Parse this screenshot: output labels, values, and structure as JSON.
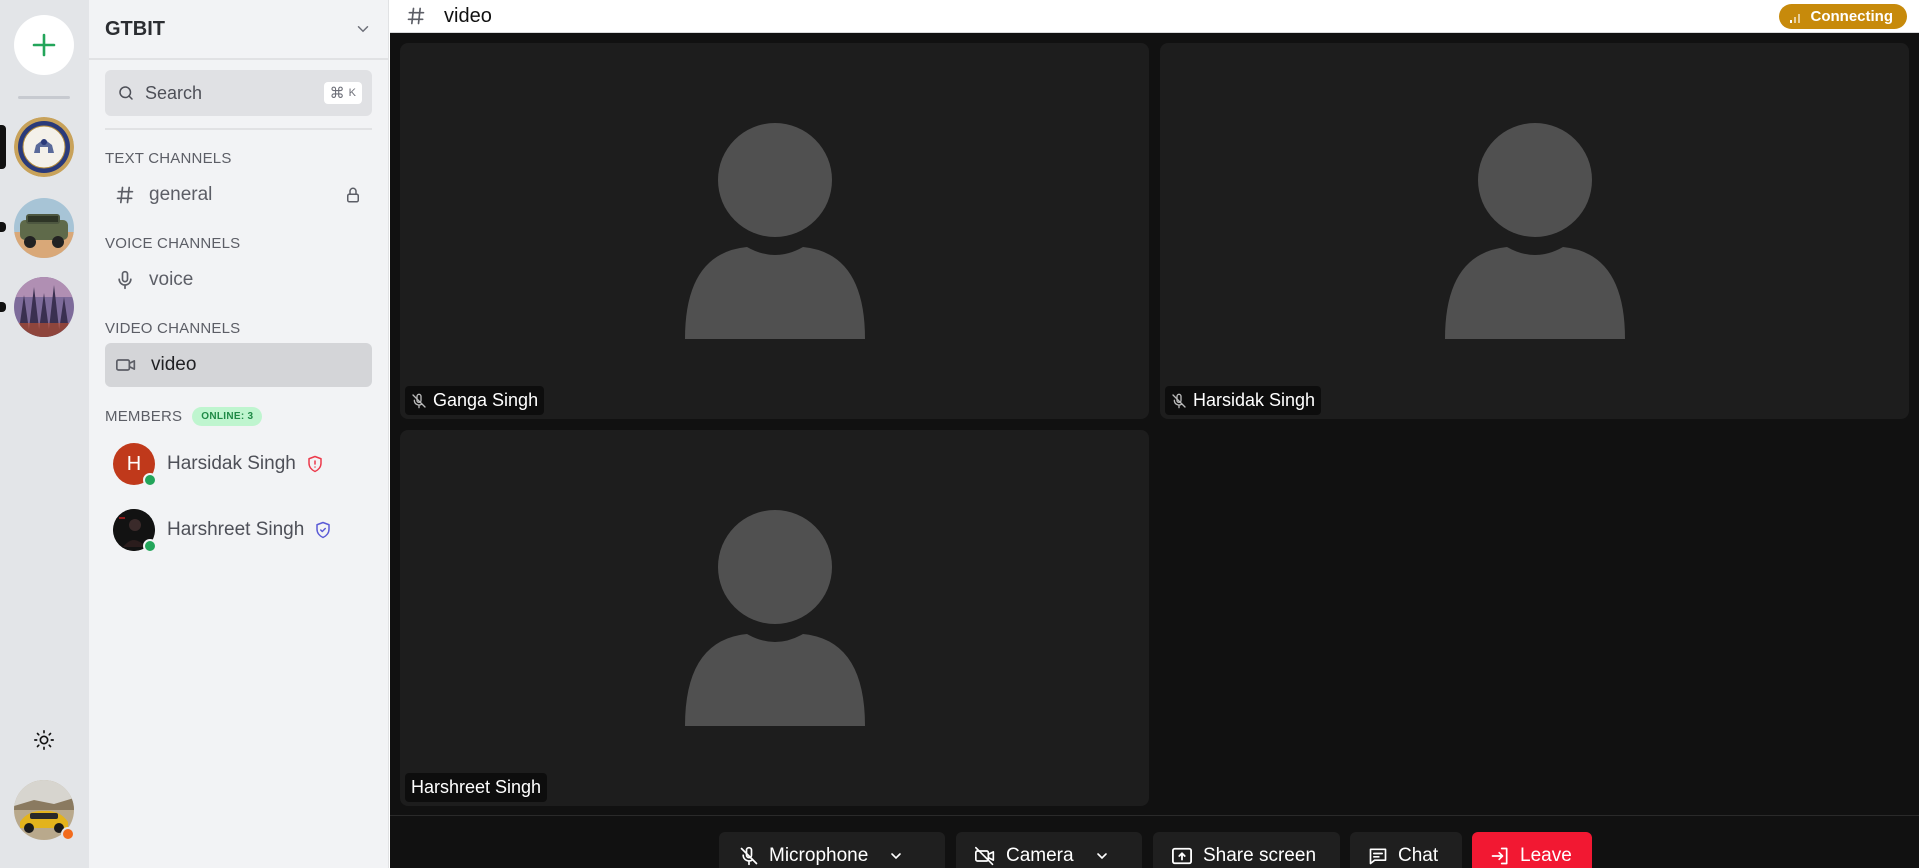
{
  "server": {
    "name": "GTBIT"
  },
  "search": {
    "label": "Search",
    "shortcut_symbol": "⌘",
    "shortcut_key": "K"
  },
  "sections": {
    "text": "TEXT CHANNELS",
    "voice": "VOICE CHANNELS",
    "video": "VIDEO CHANNELS",
    "members": "MEMBERS"
  },
  "channels": {
    "text": [
      {
        "name": "general",
        "icon": "hash-icon",
        "locked": true
      }
    ],
    "voice": [
      {
        "name": "voice",
        "icon": "microphone-icon"
      }
    ],
    "video": [
      {
        "name": "video",
        "icon": "video-camera-icon",
        "active": true
      }
    ]
  },
  "members": {
    "online_badge": "ONLINE: 3",
    "list": [
      {
        "name": "Harsidak Singh",
        "initial": "H",
        "avatar_color": "#c0391b",
        "role_icon": "shield-alert-icon",
        "role_color": "#ec3a4c",
        "status": "online"
      },
      {
        "name": "Harshreet Singh",
        "initial": "",
        "avatar_color": "#111111",
        "role_icon": "shield-check-icon",
        "role_color": "#5b5bd6",
        "status": "online"
      }
    ]
  },
  "room": {
    "channel_title": "video",
    "connection_status": "Connecting",
    "status_color": "#c78a0b"
  },
  "participants": [
    {
      "name": "Ganga Singh",
      "muted": true
    },
    {
      "name": "Harsidak Singh",
      "muted": true
    },
    {
      "name": "Harshreet Singh",
      "muted": false
    }
  ],
  "controls": {
    "microphone": "Microphone",
    "camera": "Camera",
    "share_screen": "Share screen",
    "chat": "Chat",
    "leave": "Leave"
  },
  "colors": {
    "accent_add": "#23a55a",
    "leave": "#f21832",
    "online": "#23a55a",
    "self_status": "#f26b1d"
  }
}
